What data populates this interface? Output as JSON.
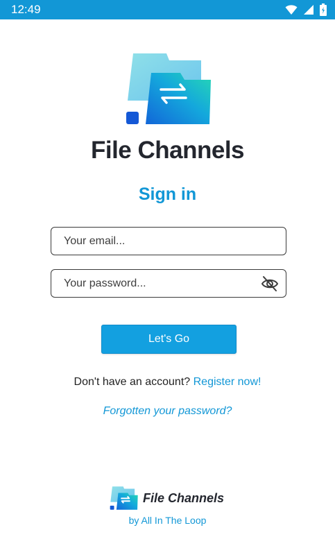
{
  "status_bar": {
    "time": "12:49",
    "icons": [
      "wifi-icon",
      "signal-icon",
      "battery-icon"
    ],
    "background": "#1297d6"
  },
  "brand": {
    "name": "File Channels",
    "logo_icon": "folder-transfer-icon",
    "colors": {
      "primary": "#1297d6",
      "teal": "#1ec8b0",
      "dark_text": "#23262e"
    }
  },
  "form": {
    "title": "Sign in",
    "email_placeholder": "Your email...",
    "email_value": "",
    "password_placeholder": "Your password...",
    "password_value": "",
    "password_toggle_icon": "eye-off-icon",
    "submit_label": "Let's Go"
  },
  "links": {
    "register_prompt": "Don't have an account?",
    "register_label": "Register now!",
    "forgot_label": "Forgotten your password?"
  },
  "footer": {
    "brand_name": "File Channels",
    "byline": "by All In The Loop"
  }
}
